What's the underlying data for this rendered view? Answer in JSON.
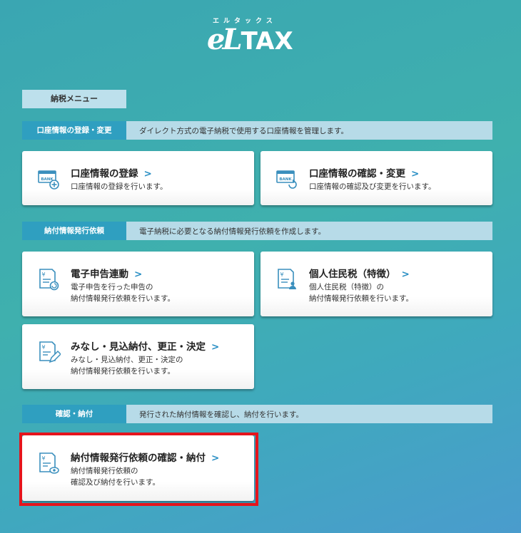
{
  "logo": {
    "kana": "エルタックス",
    "mark_e": "e",
    "mark_l": "L",
    "mark_tax": "TAX"
  },
  "menu_label": "納税メニュー",
  "sections": [
    {
      "tag": "口座情報の登録・変更",
      "desc": "ダイレクト方式の電子納税で使用する口座情報を管理します。"
    },
    {
      "tag": "納付情報発行依頼",
      "desc": "電子納税に必要となる納付情報発行依頼を作成します。"
    },
    {
      "tag": "確認・納付",
      "desc": "発行された納付情報を確認し、納付を行います。"
    }
  ],
  "cards": {
    "account_register": {
      "title": "口座情報の登録",
      "chev": ">",
      "sub1": "口座情報の登録を行います。"
    },
    "account_confirm": {
      "title": "口座情報の確認・変更",
      "chev": ">",
      "sub1": "口座情報の確認及び変更を行います。"
    },
    "e_filing": {
      "title": "電子申告連動",
      "chev": ">",
      "sub1": "電子申告を行った申告の",
      "sub2": "納付情報発行依頼を行います。"
    },
    "resident_tax": {
      "title": "個人住民税（特徴）",
      "chev": ">",
      "sub1": "個人住民税（特徴）の",
      "sub2": "納付情報発行依頼を行います。"
    },
    "deemed": {
      "title": "みなし・見込納付、更正・決定",
      "chev": ">",
      "sub1": "みなし・見込納付、更正・決定の",
      "sub2": "納付情報発行依頼を行います。"
    },
    "confirm_pay": {
      "title": "納付情報発行依頼の確認・納付",
      "chev": ">",
      "sub1": "納付情報発行依頼の",
      "sub2": "確認及び納付を行います。"
    }
  },
  "icon_text": {
    "bank": "BANK",
    "yen": "¥"
  },
  "colors": {
    "accent": "#2f9fc0",
    "highlight": "#e5141c",
    "icon": "#3a8fbd"
  }
}
